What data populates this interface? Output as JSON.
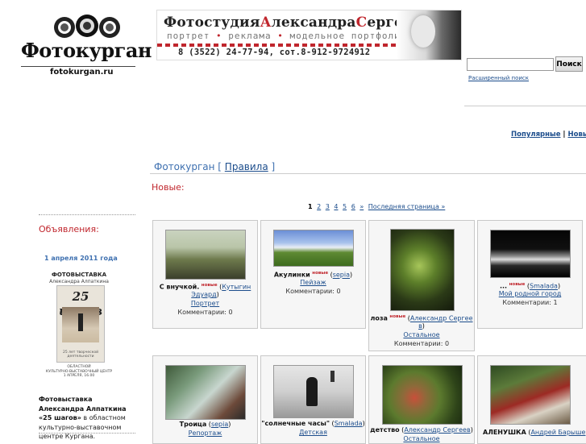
{
  "site": {
    "logo_title": "Фотокурган",
    "logo_sub": "fotokurgan.ru"
  },
  "banner": {
    "title_parts": [
      "Фотостудия",
      "А",
      "лександра",
      "С",
      "ергеева"
    ],
    "subtitle": [
      "портрет",
      "реклама",
      "модельное",
      "портфолио"
    ],
    "phone": "8 (3522) 24-77-94, сот.8-912-9724912"
  },
  "search": {
    "placeholder": "",
    "button": "Поиск",
    "advanced": "Расширенный поиск"
  },
  "top_links": {
    "popular": "Популярные",
    "new": "Новые:"
  },
  "crumb": {
    "site": "Фотокурган",
    "rules": "Правила"
  },
  "section_title": "Новые:",
  "pager": {
    "current": "1",
    "pages": [
      "2",
      "3",
      "4",
      "5",
      "6"
    ],
    "next": "»",
    "last": "Последняя страница »"
  },
  "announce": {
    "title": "Объявления:",
    "date": "1 апреля 2011 года",
    "poster": {
      "line1": "ФОТОВЫСТАВКА",
      "line2": "Александра Алпаткина",
      "number": "25 шагов",
      "caption": "25 лет творческой деятельности",
      "footer1": "ОБЛАСТНОЙ",
      "footer2": "КУЛЬТУРНО-ВЫСТАВОЧНЫЙ ЦЕНТР",
      "footer3": "1 АПРЕЛЯ, 16.00"
    },
    "bold": "Фотовыставка Александра Алпаткина «25 шагов»",
    "rest": " в областном культурно-выставочном центре Кургана."
  },
  "new_badge": "новые",
  "comments_label": "Комментарии:",
  "photos": [
    {
      "title": "С внучкой.",
      "author_first": "Кутыгин",
      "author_second": "Эдуард",
      "category": "Портрет",
      "comments": "0"
    },
    {
      "title": "Акулинки",
      "author": "sepia",
      "category": "Пейзаж",
      "comments": "0"
    },
    {
      "title": "лоза",
      "author_first": "Александр Сергее",
      "author_second": "в",
      "category": "Остальное",
      "comments": "0"
    },
    {
      "title": "...",
      "author": "Smalada",
      "category": "Мой родной город",
      "comments": "1"
    },
    {
      "title": "Троица",
      "author": "sepia",
      "category": "Репортаж",
      "comments": ""
    },
    {
      "title": "\"солнечные часы\"",
      "author": "Smalada",
      "category": "Детская",
      "comments": ""
    },
    {
      "title": "детство",
      "author": "Александр Сергеев",
      "category": "Остальное",
      "comments": ""
    },
    {
      "title": "АЛЕНУШКА",
      "author": "Андрей Барыше",
      "category": "",
      "comments": ""
    }
  ],
  "colors": {
    "accent_red": "#c0262d",
    "link_blue": "#1c4d8c",
    "crumb_blue": "#3e70b0"
  }
}
